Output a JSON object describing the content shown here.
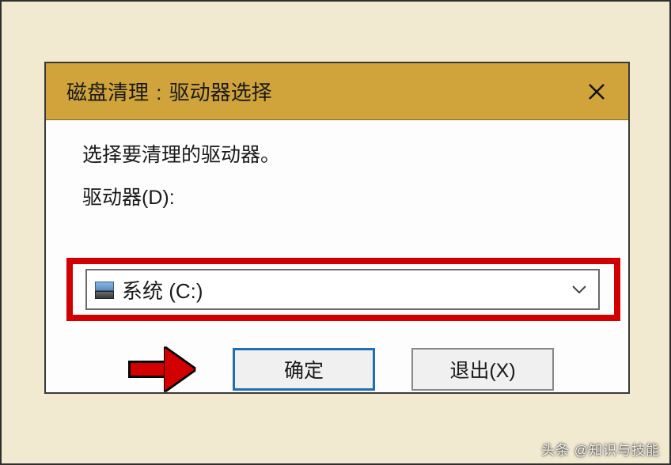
{
  "dialog": {
    "title": "磁盘清理 : 驱动器选择",
    "instruction": "选择要清理的驱动器。",
    "drive_label": "驱动器(D):",
    "selected_drive": "系统 (C:)",
    "ok_label": "确定",
    "exit_label": "退出(X)"
  },
  "watermark": "头条 @知识与技能"
}
